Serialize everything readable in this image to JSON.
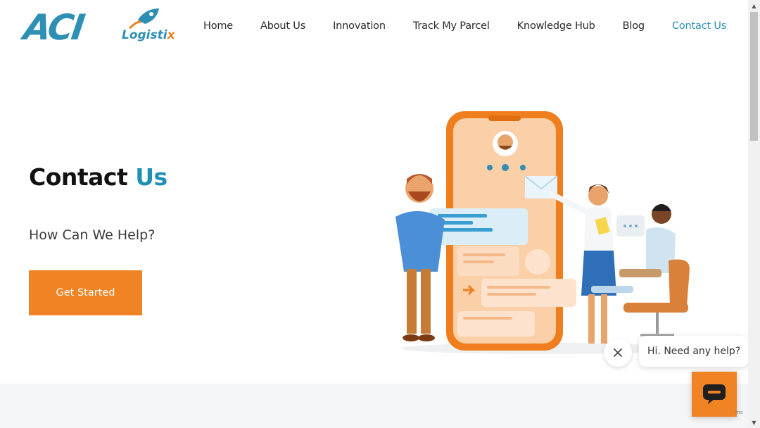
{
  "brand": {
    "logo_mark": "ACI",
    "logo_sub_main": "Logisti",
    "logo_sub_x": "x",
    "accent_color": "#2e8fb5",
    "orange_color": "#f08424"
  },
  "nav": {
    "items": [
      {
        "label": "Home"
      },
      {
        "label": "About Us"
      },
      {
        "label": "Innovation"
      },
      {
        "label": "Track My Parcel"
      },
      {
        "label": "Knowledge Hub"
      },
      {
        "label": "Blog"
      },
      {
        "label": "Contact Us",
        "active": true
      }
    ]
  },
  "hero": {
    "title_main": "Contact ",
    "title_accent": "Us",
    "subtitle": "How Can We Help?",
    "cta_label": "Get Started"
  },
  "chat": {
    "greeting": "Hi. Need any help?",
    "close_icon": "close-icon",
    "launcher_icon": "chat-icon"
  },
  "recaptcha": {
    "text": "ms"
  }
}
